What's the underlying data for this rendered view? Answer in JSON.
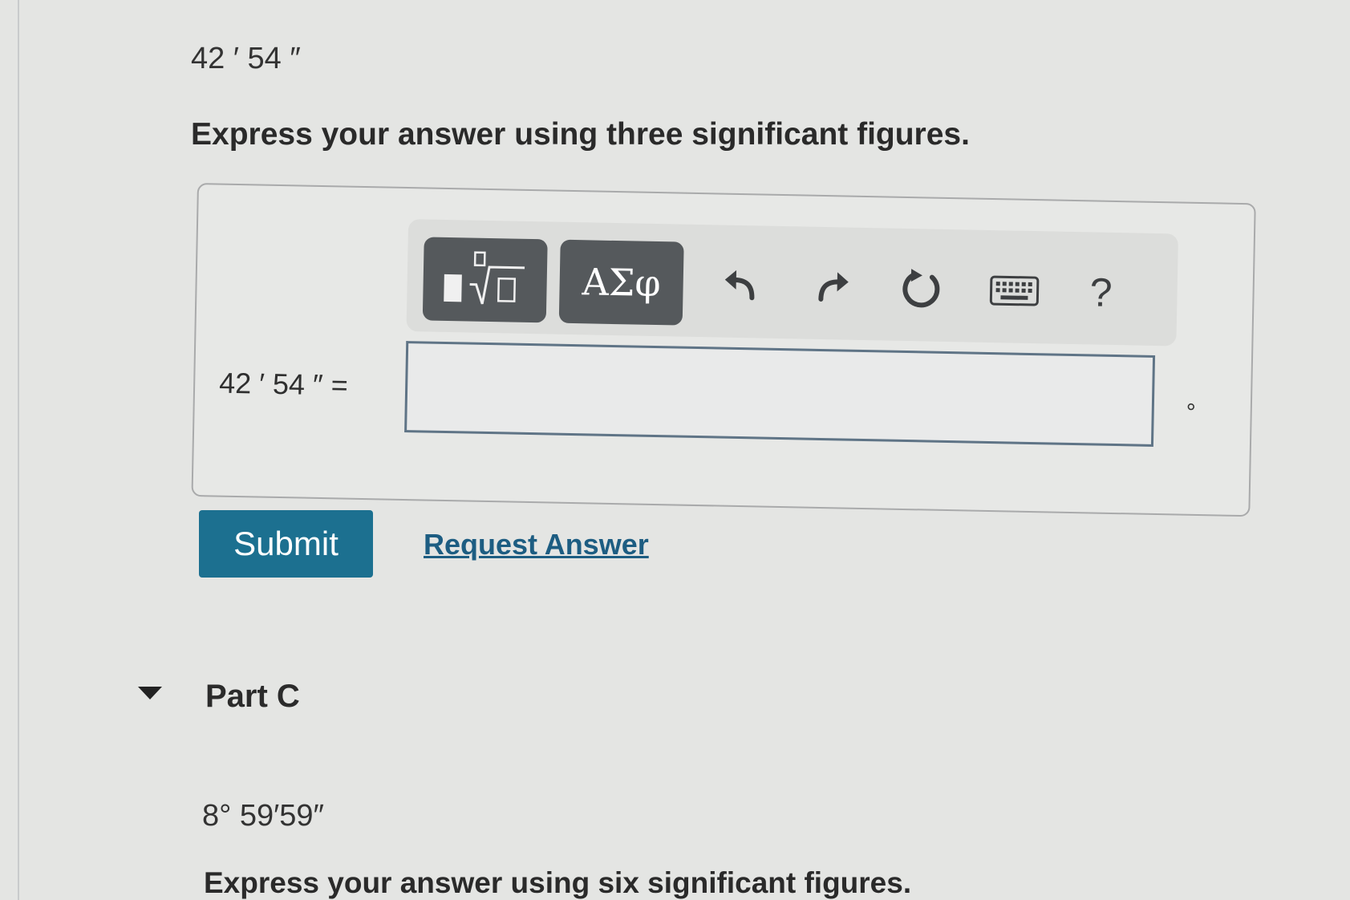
{
  "part_b": {
    "given_value": "42 ′ 54 ″",
    "instruction": "Express your answer using three significant figures.",
    "toolbar": {
      "templates_icon": "template-radical-icon",
      "symbols_label": "ΑΣφ",
      "undo_icon": "undo-icon",
      "redo_icon": "redo-icon",
      "reset_icon": "reset-icon",
      "keyboard_icon": "keyboard-icon",
      "help_label": "?"
    },
    "equation_label": "42 ′ 54 ″ =",
    "answer_value": "",
    "unit": "°",
    "submit_label": "Submit",
    "request_label": "Request Answer"
  },
  "part_c": {
    "title": "Part C",
    "given_value": "8° 59′59″",
    "instruction": "Express your answer using six significant figures."
  },
  "colors": {
    "submit_bg": "#1c7090",
    "link": "#1d5d82",
    "toolbar_button": "#55595c"
  }
}
